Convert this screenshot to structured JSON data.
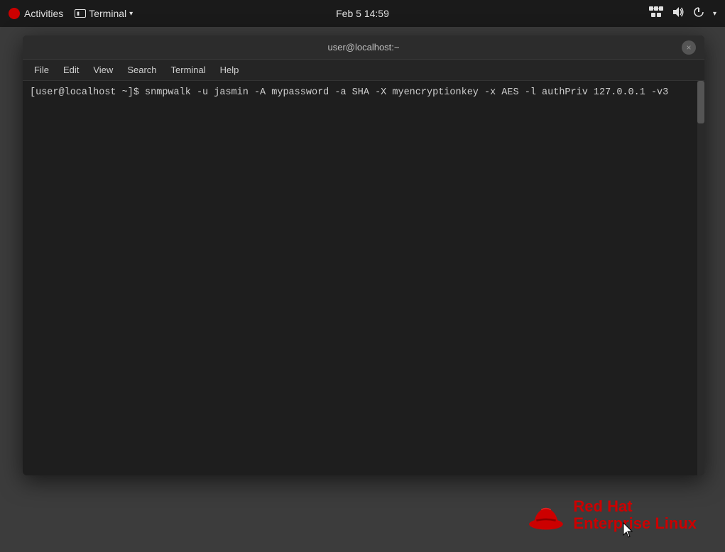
{
  "systembar": {
    "activities_label": "Activities",
    "terminal_label": "Terminal",
    "datetime": "Feb 5  14:59",
    "dropdown_arrow": "▾"
  },
  "terminal": {
    "title": "user@localhost:~",
    "close_btn": "×",
    "menu": {
      "file": "File",
      "edit": "Edit",
      "view": "View",
      "search": "Search",
      "terminal": "Terminal",
      "help": "Help"
    },
    "prompt_line": "[user@localhost ~]$ snmpwalk -u jasmin -A mypassword -a SHA -X myencryptionkey -x AES -l authPriv 127.0.0.1 -v3"
  },
  "redhat": {
    "line1": "Red Hat",
    "line2": "Enterprise Linux"
  }
}
